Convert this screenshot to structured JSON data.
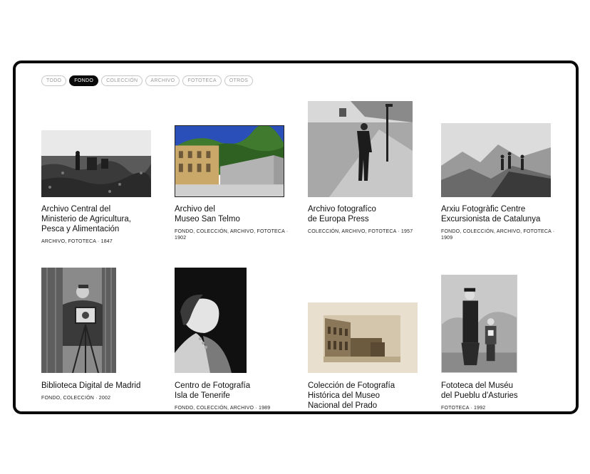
{
  "filters": [
    {
      "label": "TODO",
      "active": false
    },
    {
      "label": "FONDO",
      "active": true
    },
    {
      "label": "COLECCIÓN",
      "active": false
    },
    {
      "label": "ARCHIVO",
      "active": false
    },
    {
      "label": "FOTOTECA",
      "active": false
    },
    {
      "label": "OTROS",
      "active": false
    }
  ],
  "cards": [
    {
      "title": "Archivo Central del\nMinisterio de Agricultura,\nPesca y Alimentación",
      "meta": "ARCHIVO, FOTOTECA · 1847"
    },
    {
      "title": "Archivo del\nMuseo San Telmo",
      "meta": "FONDO, COLECCIÓN, ARCHIVO, FOTOTECA ·\n1902"
    },
    {
      "title": "Archivo fotografíco\nde Europa Press",
      "meta": "COLECCIÓN, ARCHIVO, FOTOTECA · 1957"
    },
    {
      "title": "Arxiu Fotogràfic Centre\nExcursionista de Catalunya",
      "meta": "FONDO, COLECCIÓN, ARCHIVO, FOTOTECA ·\n1909"
    },
    {
      "title": "Biblioteca Digital de Madrid",
      "meta": "FONDO, COLECCIÓN · 2002"
    },
    {
      "title": "Centro de Fotografía\nIsla de Tenerife",
      "meta": "FONDO, COLECCIÓN, ARCHIVO · 1989"
    },
    {
      "title": "Colección de Fotografía\nHistórica del Museo\nNacional del Prado",
      "meta": ""
    },
    {
      "title": "Fototeca del Muséu\ndel Pueblu d'Asturies",
      "meta": "FOTOTECA · 1992"
    }
  ]
}
